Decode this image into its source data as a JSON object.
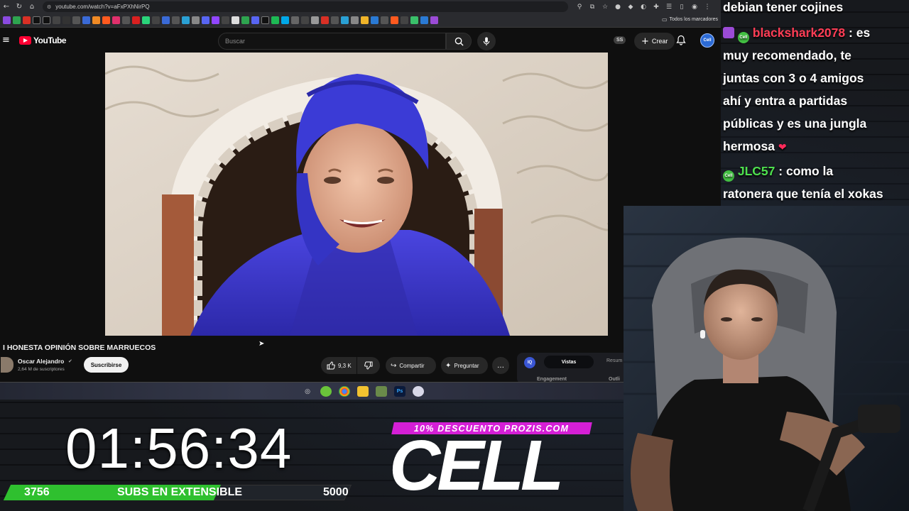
{
  "browser": {
    "url": "youtube.com/watch?v=aFxPXhNirPQ",
    "bookmarks_folder_label": "Todos los marcadores"
  },
  "youtube": {
    "logo_text": "YouTube",
    "search_placeholder": "Buscar",
    "ss_badge": "SS",
    "create_label": "Crear",
    "avatar_text": "Cell"
  },
  "video": {
    "title": "I HONESTA OPINIÓN SOBRE MARRUECOS",
    "channel_name": "Oscar Alejandro",
    "subscribers": "2,64 M de suscriptores",
    "subscribe_label": "Suscribirse",
    "likes": "9,3 K",
    "share_label": "Compartir",
    "ask_label": "Preguntar",
    "more_icon": "…"
  },
  "analytics": {
    "icon_text": "IQ",
    "tab_active": "Vistas",
    "tab_other": "Resum",
    "label_left": "Engagement",
    "label_right": "Outli"
  },
  "overlay": {
    "timer": "01:56:34",
    "sub_goal": {
      "current": "3756",
      "label": "SUBS EN EXTENSIBLE",
      "goal": "5000",
      "progress_fraction": 0.751
    },
    "promo_text": "10% DESCUENTO PROZIS.COM",
    "brand_logo": "CELL"
  },
  "chat": {
    "lines": [
      {
        "text": "debian tener cojines"
      },
      {
        "user": "blackshark2078",
        "text": ": es"
      },
      {
        "text": "muy recomendado, te"
      },
      {
        "text": "juntas con 3 o 4 amigos"
      },
      {
        "text": "ahí y entra a partidas"
      },
      {
        "text": "públicas y es una jungla"
      },
      {
        "text": "hermosa"
      },
      {
        "user": "JLC57",
        "text": ": como la"
      },
      {
        "text": "ratonera que tenía el xokas"
      }
    ],
    "badge_text": "Cell"
  },
  "colors": {
    "youtube_red": "#ff0033",
    "promo_magenta": "#d51fd6",
    "goal_green": "#2fc02f",
    "chat_user_red": "#ff3d55",
    "chat_user_green": "#4ee04e",
    "robe_blue": "#3b3bd6"
  }
}
